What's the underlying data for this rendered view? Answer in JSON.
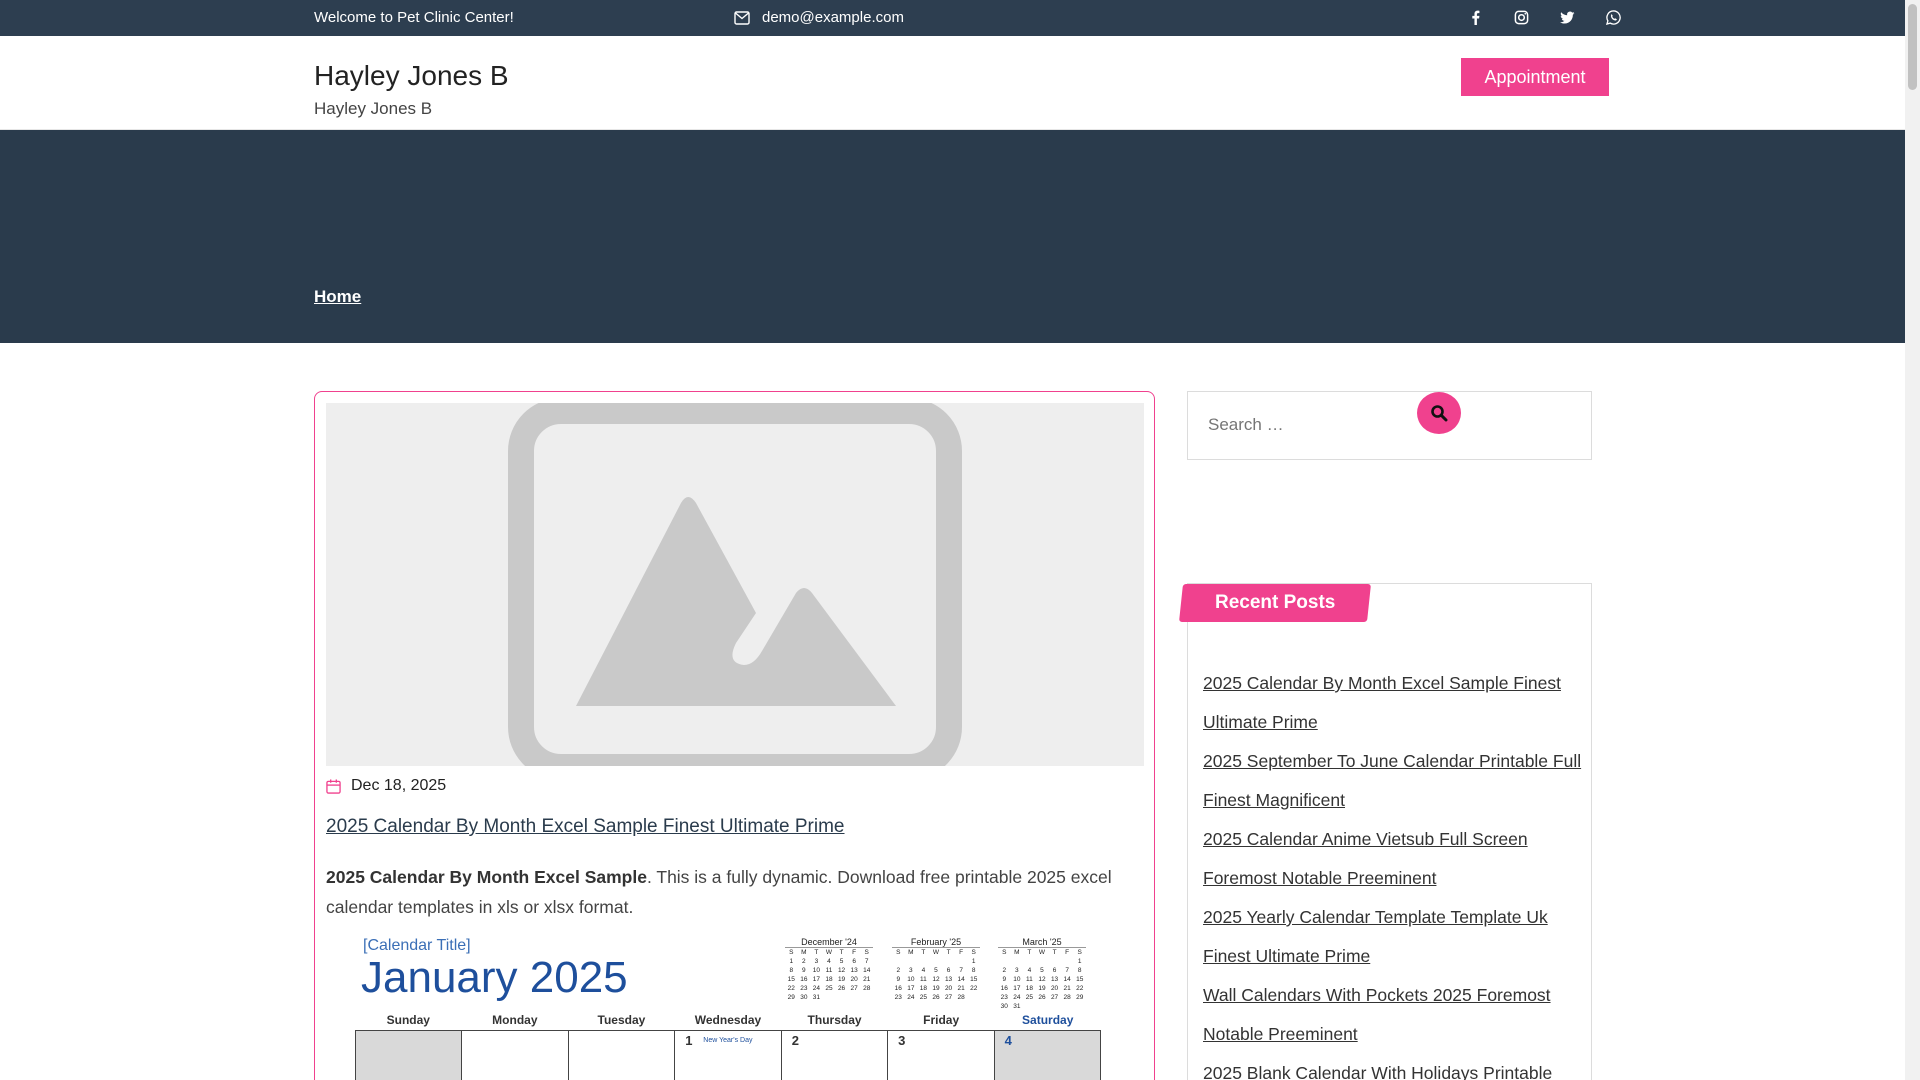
{
  "topbar": {
    "welcome": "Welcome to Pet Clinic Center!",
    "email": "demo@example.com",
    "socials": [
      "facebook-icon",
      "instagram-icon",
      "twitter-icon",
      "whatsapp-icon"
    ]
  },
  "header": {
    "site_title": "Hayley Jones B",
    "tagline": "Hayley Jones B",
    "appointment_label": "Appointment"
  },
  "nav": {
    "home": "Home"
  },
  "post": {
    "date": "Dec 18, 2025",
    "title": "2025 Calendar By Month Excel Sample Finest Ultimate Prime",
    "excerpt_bold": "2025 Calendar By Month Excel Sample",
    "excerpt_rest": ". This is a fully dynamic. Download free printable 2025 excel calendar templates in xls or xlsx format."
  },
  "calendar_image": {
    "title_placeholder": "[Calendar Title]",
    "month": "January  2025",
    "mini_months": [
      "December '24",
      "February '25",
      "March '25"
    ],
    "day_names": [
      "Sunday",
      "Monday",
      "Tuesday",
      "Wednesday",
      "Thursday",
      "Friday",
      "Saturday"
    ],
    "first_row": [
      "",
      "",
      "",
      "1",
      "2",
      "3",
      "4"
    ],
    "holiday": "New Year's Day"
  },
  "sidebar": {
    "search_placeholder": "Search …",
    "recent_title": "Recent Posts",
    "recent_posts": [
      "2025 Calendar By Month Excel Sample Finest Ultimate Prime",
      "2025 September To June Calendar Printable Full Finest Magnificent",
      "2025 Calendar Anime Vietsub Full Screen Foremost Notable Preeminent",
      "2025 Yearly Calendar Template Template Uk Finest Ultimate Prime",
      "Wall Calendars With Pockets 2025 Foremost Notable Preeminent",
      "2025 Blank Calendar With Holidays Printable"
    ]
  },
  "colors": {
    "accent": "#f0418e",
    "dark": "#2d3e50"
  }
}
